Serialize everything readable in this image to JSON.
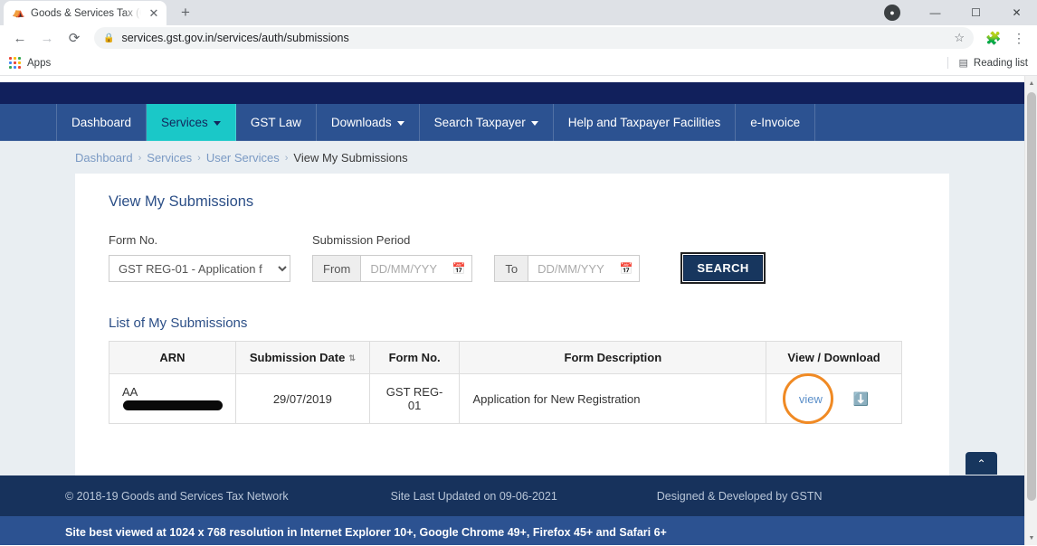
{
  "browser": {
    "tab": {
      "title": "Goods & Services Tax (GST) | Use",
      "favicon": "emblem-icon",
      "close": "✕"
    },
    "new_tab": "+",
    "window_controls": {
      "profile": "●",
      "minimize": "—",
      "maximize": "❐",
      "close": "✕"
    },
    "nav": {
      "back": "←",
      "forward": "→",
      "reload": "⟳"
    },
    "omnibox": {
      "lock": "ὑ2",
      "url": "services.gst.gov.in/services/auth/submissions",
      "star": "☆"
    },
    "extensions_icon": "❖",
    "menu_icon": "⋮",
    "bookmarks": {
      "apps_label": "Apps",
      "reading_list_label": "Reading list",
      "reading_list_icon": "☷"
    }
  },
  "page": {
    "nav_items": [
      {
        "label": "Dashboard",
        "has_caret": false,
        "active": false
      },
      {
        "label": "Services",
        "has_caret": true,
        "active": true
      },
      {
        "label": "GST Law",
        "has_caret": false,
        "active": false
      },
      {
        "label": "Downloads",
        "has_caret": true,
        "active": false
      },
      {
        "label": "Search Taxpayer",
        "has_caret": true,
        "active": false
      },
      {
        "label": "Help and Taxpayer Facilities",
        "has_caret": false,
        "active": false
      },
      {
        "label": "e-Invoice",
        "has_caret": false,
        "active": false
      }
    ],
    "breadcrumb": {
      "items": [
        "Dashboard",
        "Services",
        "User Services"
      ],
      "current": "View My Submissions",
      "separator": "›"
    },
    "card": {
      "title": "View My Submissions",
      "form_no": {
        "label": "Form No.",
        "selected": "GST REG-01 - Application f",
        "options": [
          "GST REG-01 - Application f"
        ]
      },
      "submission_period": {
        "label": "Submission Period",
        "from_addon": "From",
        "from_value": "",
        "from_placeholder": "DD/MM/YYYY",
        "to_addon": "To",
        "to_value": "",
        "to_placeholder": "DD/MM/YYYY",
        "calendar_icon": "Ὄ5"
      },
      "search_button": "SEARCH",
      "list_title": "List of My Submissions",
      "table": {
        "columns": [
          "ARN",
          "Submission Date",
          "Form No.",
          "Form Description",
          "View / Download"
        ],
        "sortable_column": "Submission Date",
        "sort_icon": "⇅",
        "rows": [
          {
            "arn_prefix": "AA",
            "arn_redacted": true,
            "submission_date": "29/07/2019",
            "form_no": "GST REG-01",
            "form_description": "Application for New Registration",
            "view_label": "view",
            "download_icon": "download-icon"
          }
        ]
      }
    },
    "scroll_top_icon": "⌃",
    "footer": {
      "copyright": "© 2018-19 Goods and Services Tax Network",
      "last_updated": "Site Last Updated on 09-06-2021",
      "designed_by": "Designed & Developed by GSTN",
      "best_viewed": "Site best viewed at 1024 x 768 resolution in Internet Explorer 10+, Google Chrome 49+, Firefox 45+ and Safari 6+"
    }
  },
  "colors": {
    "nav_bar": "#2c5291",
    "nav_top": "#11205c",
    "active_tab": "#1ac8c8",
    "footer_dark": "#17325c",
    "annotation": "#f08a24",
    "link": "#5b8fc9",
    "button": "#17365e"
  }
}
